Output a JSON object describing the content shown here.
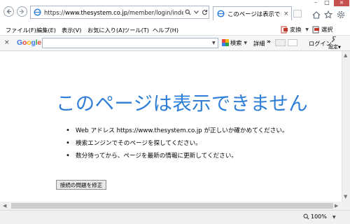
{
  "window": {
    "minimize_glyph": "–",
    "maximize_glyph": "□",
    "close_glyph": "×"
  },
  "address_bar": {
    "url_prefix": "https://",
    "url_domain": "www.thesystem.co.jp",
    "url_path": "/member/login/index.html?id",
    "icons": [
      "search-icon",
      "dropdown-arrow-icon",
      "refresh-icon"
    ]
  },
  "tab": {
    "label": "このページは表示できま...",
    "close_glyph": "×"
  },
  "toolbar_right_icons": [
    "home-icon",
    "favorites-star-icon",
    "settings-gear-icon"
  ],
  "menu": {
    "items": [
      "ファイル(F)",
      "編集(E)",
      "表示(V)",
      "お気に入り(A)",
      "ツール(T)",
      "ヘルプ(H)"
    ],
    "convert_label": "変換",
    "select_label": "選択"
  },
  "google_toolbar": {
    "logo": [
      "G",
      "o",
      "o",
      "g",
      "l",
      "e"
    ],
    "logo_colors": [
      "#3b7ded",
      "#e8453c",
      "#f4b400",
      "#3b7ded",
      "#2ba24c",
      "#e8453c"
    ],
    "search_label": "検索",
    "detail_label": "詳細",
    "more_glyph": "»",
    "login_label": "ログイン",
    "settings_label": "設定"
  },
  "error_page": {
    "title": "このページは表示できません",
    "bullets": [
      "Web アドレス https://www.thesystem.co.jp が正しいか確かめてください。",
      "検索エンジンでそのページを探してください。",
      "数分待ってから、ページを最新の情報に更新してください。"
    ],
    "fix_button": "接続の問題を修正",
    "title_color": "#2f7ed8"
  },
  "status_bar": {
    "zoom_level": "100%"
  }
}
